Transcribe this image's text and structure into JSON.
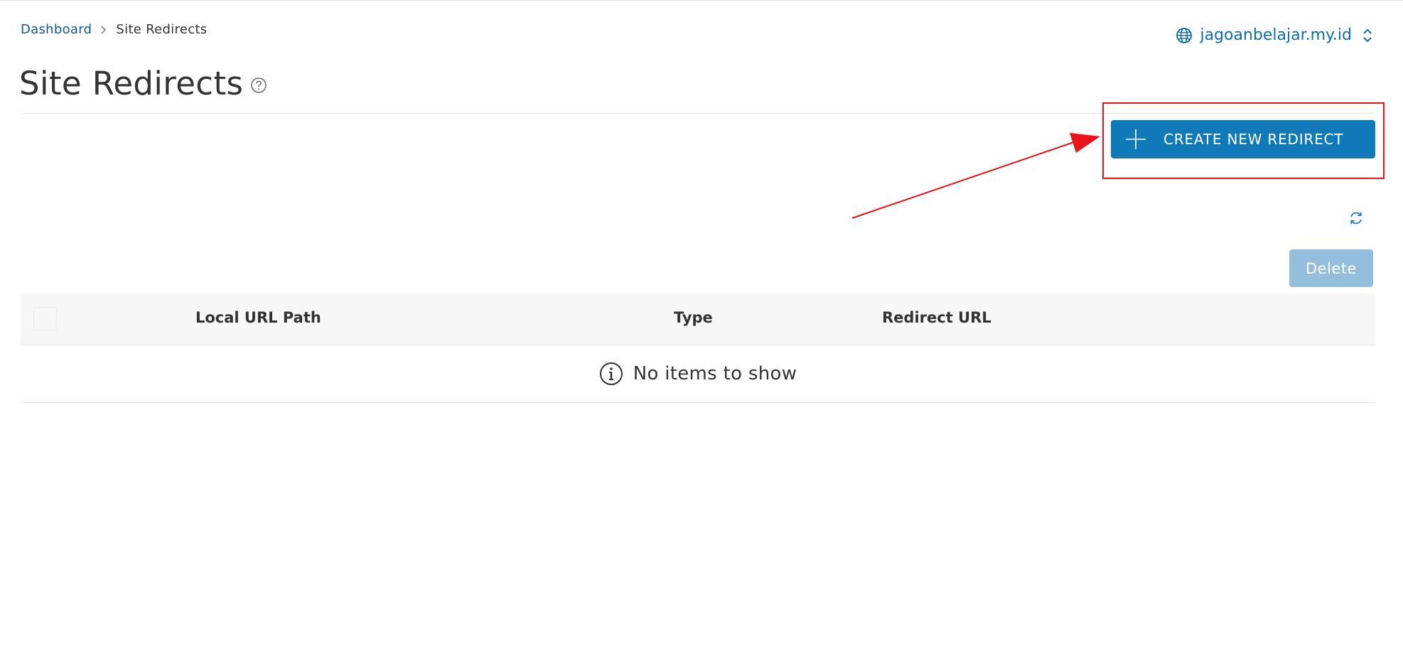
{
  "breadcrumb": {
    "home": "Dashboard",
    "current": "Site Redirects"
  },
  "site_selector": {
    "domain": "jagoanbelajar.my.id",
    "icon": "globe-icon"
  },
  "page": {
    "title": "Site Redirects"
  },
  "toolbar": {
    "create_label": "CREATE NEW REDIRECT",
    "delete_label": "Delete"
  },
  "table": {
    "columns": [
      "Local URL Path",
      "Type",
      "Redirect URL"
    ],
    "empty_message": "No items to show"
  },
  "colors": {
    "primary": "#1079b8",
    "primary_disabled": "#93bfdc",
    "link": "#0f5b94",
    "annotation": "#e8141a"
  }
}
